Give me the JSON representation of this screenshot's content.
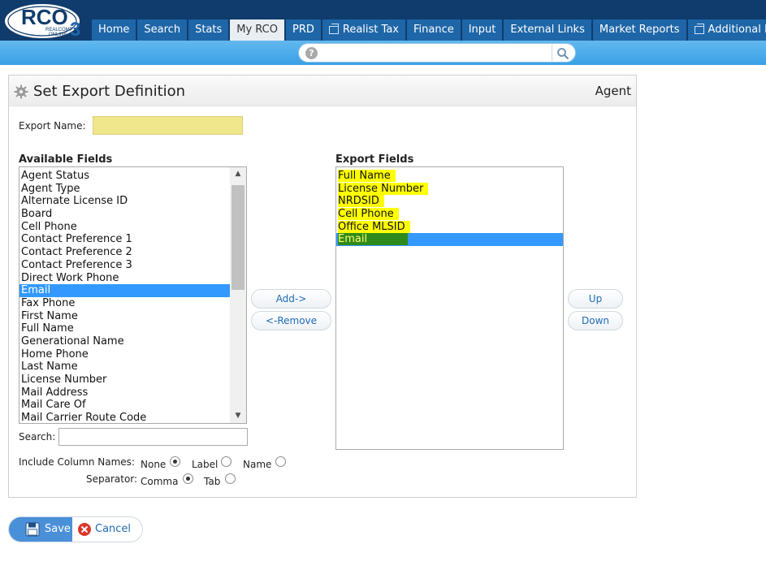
{
  "logo": {
    "text": "RCO",
    "sub1": "REALCOMP",
    "sub2": "ONLINE",
    "sup": "3"
  },
  "nav": [
    {
      "label": "Home",
      "icon": null,
      "active": false
    },
    {
      "label": "Search",
      "icon": null,
      "active": false
    },
    {
      "label": "Stats",
      "icon": null,
      "active": false
    },
    {
      "label": "My RCO",
      "icon": null,
      "active": true
    },
    {
      "label": "PRD",
      "icon": null,
      "active": false
    },
    {
      "label": "Realist Tax",
      "icon": "popout-window-icon",
      "active": false
    },
    {
      "label": "Finance",
      "icon": null,
      "active": false
    },
    {
      "label": "Input",
      "icon": null,
      "active": false
    },
    {
      "label": "External Links",
      "icon": null,
      "active": false
    },
    {
      "label": "Market Reports",
      "icon": null,
      "active": false
    },
    {
      "label": "Additional Data",
      "icon": "popout-window-icon",
      "active": false
    }
  ],
  "search": {
    "value": "",
    "help_glyph": "?"
  },
  "panel": {
    "title": "Set Export Definition",
    "context": "Agent"
  },
  "form": {
    "export_name_label": "Export Name:",
    "export_name_value": "",
    "available_label": "Available Fields",
    "export_label": "Export Fields",
    "available_fields": [
      "Agent Status",
      "Agent Type",
      "Alternate License ID",
      "Board",
      "Cell Phone",
      "Contact Preference 1",
      "Contact Preference 2",
      "Contact Preference 3",
      "Direct Work Phone",
      "Email",
      "Fax Phone",
      "First Name",
      "Full Name",
      "Generational Name",
      "Home Phone",
      "Last Name",
      "License Number",
      "Mail Address",
      "Mail Care Of",
      "Mail Carrier Route Code"
    ],
    "available_selected": "Email",
    "export_fields": [
      "Full Name",
      "License Number",
      "NRDSID",
      "Cell Phone",
      "Office MLSID",
      "Email"
    ],
    "export_selected": "Email",
    "add_label": "Add->",
    "remove_label": "<-Remove",
    "up_label": "Up",
    "down_label": "Down",
    "search_label": "Search:",
    "search_value": "",
    "include_label": "Include Column Names:",
    "include_options": [
      {
        "label": "None",
        "checked": true
      },
      {
        "label": "Label",
        "checked": false
      },
      {
        "label": "Name",
        "checked": false
      }
    ],
    "separator_label": "Separator:",
    "separator_options": [
      {
        "label": "Comma",
        "checked": true
      },
      {
        "label": "Tab",
        "checked": false
      }
    ]
  },
  "actions": {
    "save_label": "Save",
    "cancel_label": "Cancel"
  },
  "colors": {
    "nav_bg": "#1e66a8",
    "topbar": "#0f3c6c",
    "accent": "#3399ff",
    "highlight": "#ffff00"
  }
}
